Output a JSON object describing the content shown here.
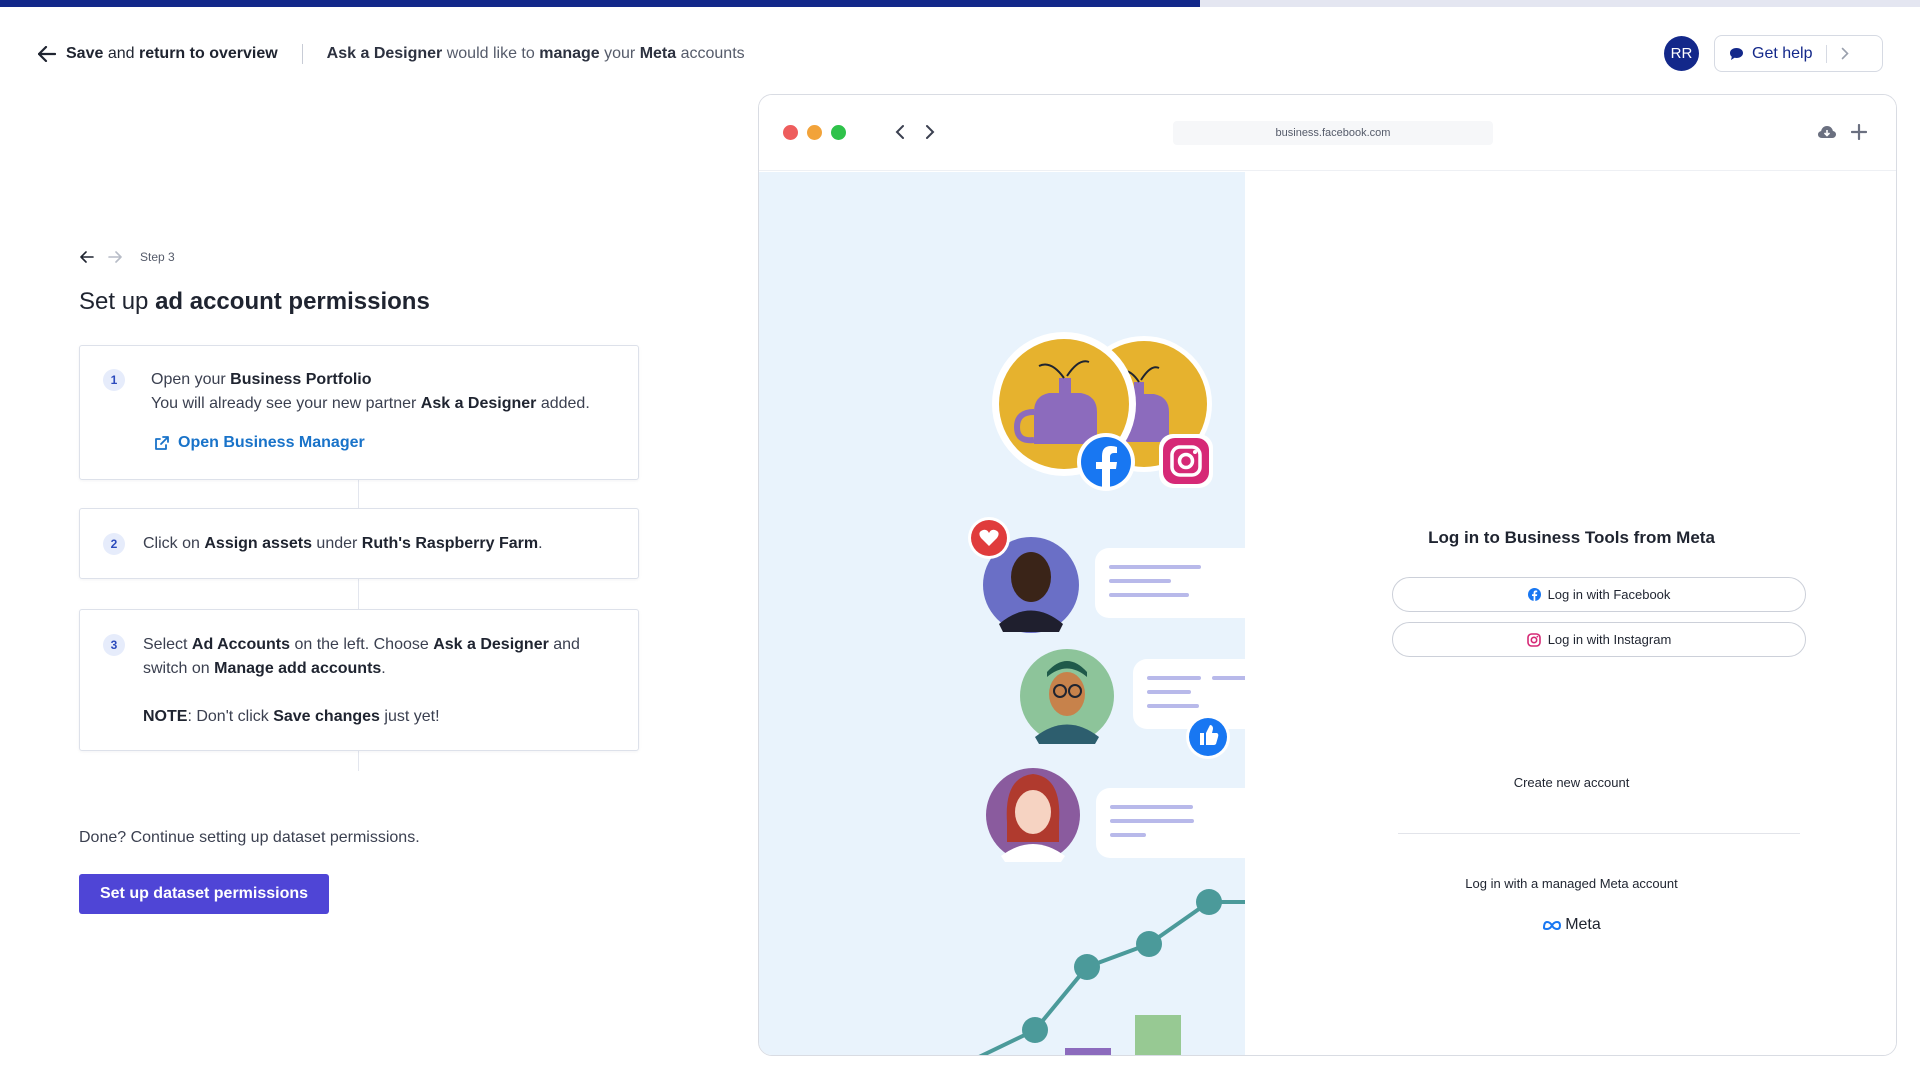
{
  "progress": {
    "fraction": 0.625,
    "color": "#13288a"
  },
  "header": {
    "back_label_bold_1": "Save",
    "back_label_mid": " and ",
    "back_label_bold_2": "return to overview",
    "request_bold_1": "Ask a Designer",
    "request_mid_1": " would like to ",
    "request_bold_2": "manage",
    "request_mid_2": " your ",
    "request_bold_3": "Meta",
    "request_mid_3": " accounts",
    "avatar_initials": "RR",
    "help_label": "Get help"
  },
  "step": {
    "label": "Step 3",
    "title_plain": "Set up ",
    "title_bold": "ad account permissions"
  },
  "cards": [
    {
      "number": "1",
      "line1_plain": "Open your ",
      "line1_bold": "Business Portfolio",
      "line2_plain": "You will already see your new partner ",
      "line2_bold": "Ask a Designer",
      "line2_end": " added.",
      "link_label": "Open Business Manager"
    },
    {
      "number": "2",
      "t1": "Click on ",
      "b1": "Assign assets",
      "t2": " under ",
      "b2": "Ruth's Raspberry Farm",
      "t3": "."
    },
    {
      "number": "3",
      "t1": "Select ",
      "b1": "Ad Accounts",
      "t2": " on the left. Choose ",
      "b2": "Ask a Designer",
      "t3": " and",
      "t4": "switch on ",
      "b3": "Manage add accounts",
      "t5": ".",
      "note_bold": "NOTE",
      "note_t1": ": Don't click ",
      "note_b": "Save changes",
      "note_t2": " just yet!"
    }
  ],
  "done_text": "Done? Continue setting up dataset permissions.",
  "cta_label": "Set up dataset permissions",
  "browser": {
    "url": "business.facebook.com",
    "login_title": "Log in to Business Tools from Meta",
    "fb_button": "Log in with Facebook",
    "ig_button": "Log in with Instagram",
    "create_account": "Create new account",
    "managed_account": "Log in with a managed Meta account",
    "meta_logo_text": "Meta"
  },
  "colors": {
    "brand_navy": "#13288a",
    "cta_purple": "#4f45d6",
    "link_blue": "#1973c9",
    "illustration_bg": "#e9f3fc"
  }
}
